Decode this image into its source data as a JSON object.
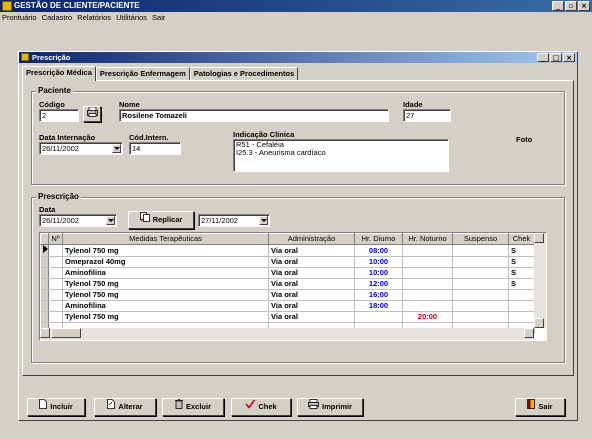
{
  "app": {
    "title": "GESTÃO DE CLIENTE/PACIENTE",
    "menu": [
      "Prontuário",
      "Cadastro",
      "Relatórios",
      "Utilitários",
      "Sair"
    ]
  },
  "window": {
    "title": "Prescrição",
    "tabs": [
      "Prescrição Médica",
      "Prescrição Enfermagem",
      "Patologias e Procedimentos"
    ],
    "active_tab": "Prescrição Médica"
  },
  "paciente": {
    "group_label": "Paciente",
    "codigo_label": "Código",
    "codigo_value": "2",
    "nome_label": "Nome",
    "nome_value": "Rosilene Tomazeli",
    "idade_label": "Idade",
    "idade_value": "27",
    "data_internacao_label": "Data Internação",
    "data_internacao_value": "26/11/2002",
    "cod_intern_label": "Cód.Intern.",
    "cod_intern_value": "14",
    "indicacao_label": "Indicação Clínica",
    "indicacao_lines": [
      "R51 - Cefaléia",
      "I25.3 - Aneurisma cardíaco"
    ],
    "foto_label": "Foto"
  },
  "prescricao": {
    "group_label": "Prescrição",
    "data_label": "Data",
    "data_value": "26/11/2002",
    "replicar_label": "Replicar",
    "replicar_date": "27/11/2002",
    "columns": [
      "Nº",
      "Medidas Terapêuticas",
      "Administração",
      "Hr. Diurno",
      "Hr. Noturno",
      "Suspenso",
      "Chek"
    ],
    "rows": [
      {
        "n": "",
        "medida": "Tylenol 750 mg",
        "admin": "Via oral",
        "diurno": "08:00",
        "noturno": "",
        "suspenso": "",
        "chek": "S"
      },
      {
        "n": "",
        "medida": "Omeprazol 40mg",
        "admin": "Via oral",
        "diurno": "10:00",
        "noturno": "",
        "suspenso": "",
        "chek": "S"
      },
      {
        "n": "",
        "medida": "Aminofilina",
        "admin": "Via oral",
        "diurno": "10:00",
        "noturno": "",
        "suspenso": "",
        "chek": "S"
      },
      {
        "n": "",
        "medida": "Tylenol 750 mg",
        "admin": "Via oral",
        "diurno": "12:00",
        "noturno": "",
        "suspenso": "",
        "chek": "S"
      },
      {
        "n": "",
        "medida": "Tylenol 750 mg",
        "admin": "Via oral",
        "diurno": "16:00",
        "noturno": "",
        "suspenso": "",
        "chek": ""
      },
      {
        "n": "",
        "medida": "Aminofilina",
        "admin": "Via oral",
        "diurno": "18:00",
        "noturno": "",
        "suspenso": "",
        "chek": ""
      },
      {
        "n": "",
        "medida": "Tylenol 750 mg",
        "admin": "Via oral",
        "diurno": "",
        "noturno": "20:00",
        "suspenso": "",
        "chek": ""
      }
    ]
  },
  "buttons": {
    "incluir": "Incluir",
    "alterar": "Alterar",
    "excluir": "Excluir",
    "chek": "Chek",
    "imprimir": "Imprimir",
    "sair": "Sair"
  },
  "colors": {
    "title_bar": "#0a246a",
    "diurno_time": "#0000cc",
    "noturno_time": "#cc0000"
  }
}
